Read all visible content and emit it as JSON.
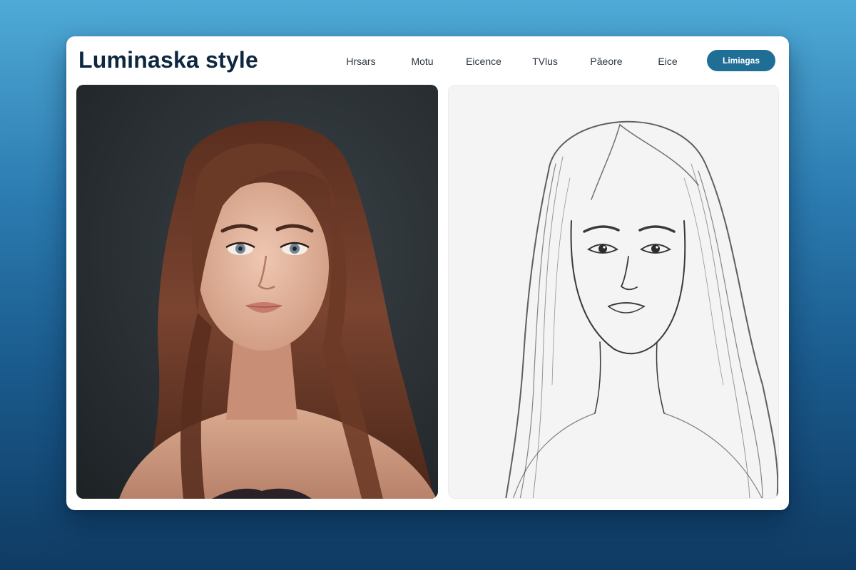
{
  "app": {
    "brand": "Luminaska style"
  },
  "nav": {
    "items": [
      {
        "label": "Hrsars"
      },
      {
        "label": "Motu"
      },
      {
        "label": "Eicence"
      },
      {
        "label": "TVlus"
      },
      {
        "label": "Păeore"
      },
      {
        "label": "Eice"
      }
    ]
  },
  "cta": {
    "label": "Limiagas"
  },
  "panels": {
    "photo": {
      "icon": "photo-portrait",
      "colors": {
        "hair": "#6b3a26",
        "skin": "#e2b49c",
        "background": "#2a3034"
      }
    },
    "sketch": {
      "icon": "pencil-sketch-portrait",
      "colors": {
        "lines": "#3a3a3a",
        "paper": "#f4f4f4"
      }
    }
  },
  "colors": {
    "accent": "#1f6e96",
    "brand_text": "#0e2740",
    "window": "#ffffff"
  }
}
